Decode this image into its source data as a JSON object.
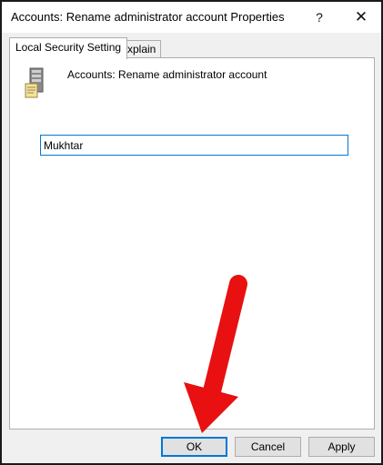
{
  "window": {
    "title": "Accounts: Rename administrator account Properties",
    "help_glyph": "?",
    "close_glyph": "✕"
  },
  "tabs": [
    {
      "label": "Local Security Setting",
      "active": true
    },
    {
      "label": "Explain",
      "active": false
    }
  ],
  "policy": {
    "name": "Accounts: Rename administrator account",
    "icon": "server-policy-icon"
  },
  "input": {
    "value": "Mukhtar"
  },
  "buttons": {
    "ok": "OK",
    "cancel": "Cancel",
    "apply": "Apply"
  },
  "annotation": {
    "arrow_color": "#e81010",
    "icon": "red-arrow-pointing-to-ok"
  },
  "colors": {
    "accent": "#0078d7"
  }
}
